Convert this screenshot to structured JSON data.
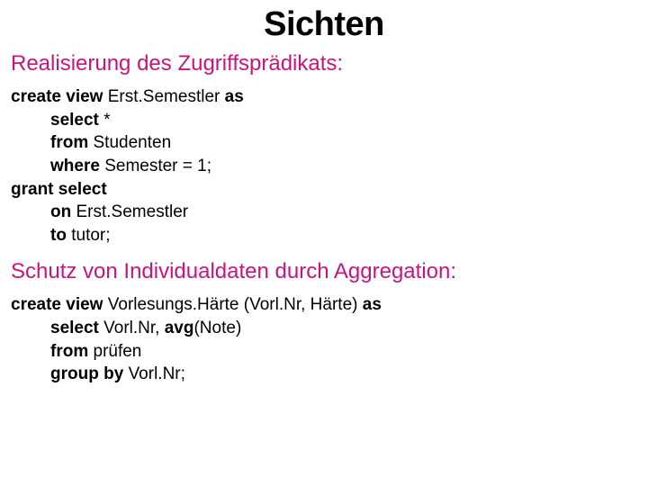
{
  "title": "Sichten",
  "section1": {
    "heading": "Realisierung des Zugriffsprädikats:",
    "l1_kw1": "create view ",
    "l1_txt": "Erst.Semestler ",
    "l1_kw2": "as",
    "l2_kw": "select ",
    "l2_txt": "*",
    "l3_kw": "from ",
    "l3_txt": "Studenten",
    "l4_kw": "where ",
    "l4_txt": "Semester = 1;",
    "l5_kw": "grant select",
    "l6_kw": "on ",
    "l6_txt": "Erst.Semestler",
    "l7_kw": "to ",
    "l7_txt": "tutor;"
  },
  "section2": {
    "heading": "Schutz von Individualdaten durch Aggregation:",
    "l1_kw1": "create view ",
    "l1_txt": "Vorlesungs.Härte (Vorl.Nr, Härte) ",
    "l1_kw2": "as",
    "l2_kw1": "select ",
    "l2_txt1": "Vorl.Nr, ",
    "l2_kw2": "avg",
    "l2_txt2": "(Note)",
    "l3_kw": "from ",
    "l3_txt": "prüfen",
    "l4_kw": "group by ",
    "l4_txt": "Vorl.Nr;"
  }
}
